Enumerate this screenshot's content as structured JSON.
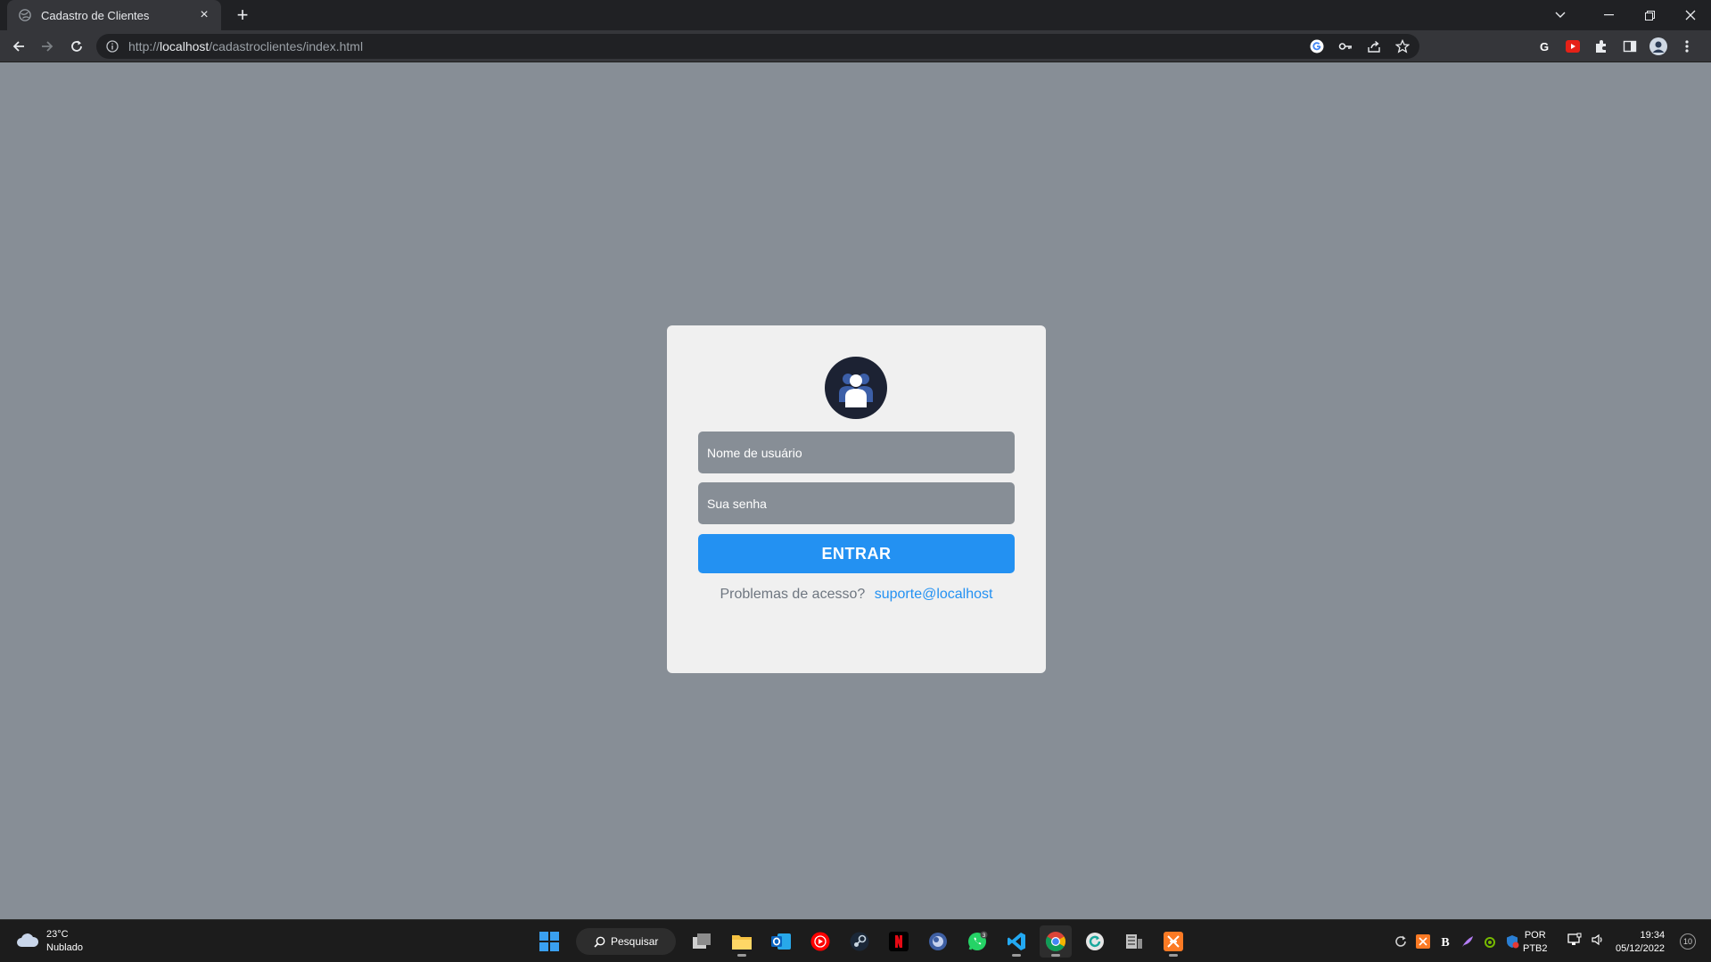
{
  "browser": {
    "tab_title": "Cadastro de Clientes",
    "tab_close": "×",
    "new_tab": "+",
    "url_scheme": "http://",
    "url_host": "localhost",
    "url_path": "/cadastroclientes/index.html"
  },
  "login": {
    "username_placeholder": "Nome de usuário",
    "password_placeholder": "Sua senha",
    "submit_label": "ENTRAR",
    "help_question": "Problemas de acesso?",
    "support_email": "suporte@localhost"
  },
  "taskbar": {
    "weather_temp": "23°C",
    "weather_desc": "Nublado",
    "search_label": "Pesquisar",
    "whatsapp_badge": "3",
    "lang_line1": "POR",
    "lang_line2": "PTB2",
    "time": "19:34",
    "date": "05/12/2022",
    "notifications": "10"
  },
  "colors": {
    "page_bg": "#878e96",
    "card_bg": "#f0f0f0",
    "button": "#2391f2",
    "link": "#2391f2",
    "avatar_bg": "#1c2233"
  }
}
